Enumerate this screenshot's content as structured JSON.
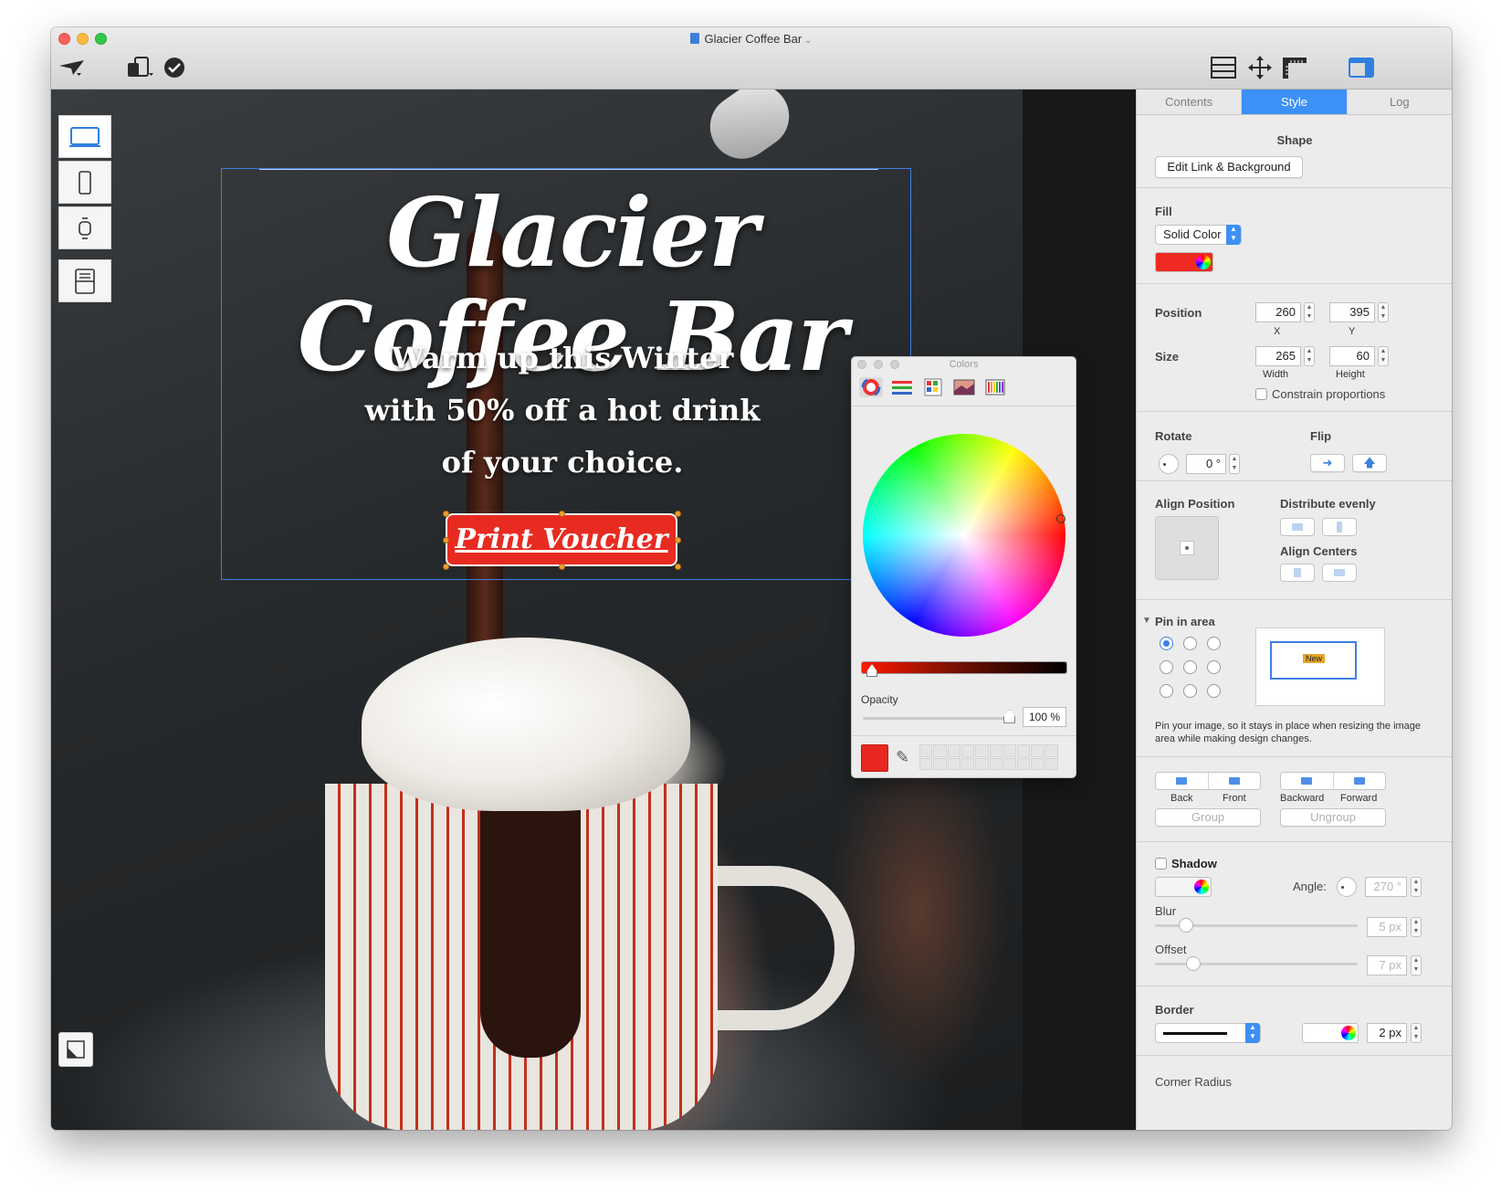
{
  "window": {
    "title": "Glacier Coffee Bar"
  },
  "toolbar": {
    "icons": [
      "paper-plane-icon",
      "devices-icon",
      "checkmark-icon",
      "layout-icon",
      "move-icon",
      "ruler-icon",
      "sidebar-icon"
    ]
  },
  "canvas": {
    "headline": "Glacier Coffee Bar",
    "subline": "Warm up this Winter with 50% off a hot drink of your choice.",
    "button_label": "Print Voucher",
    "device_buttons": [
      "desktop-icon",
      "phone-icon",
      "watch-icon",
      "email-icon"
    ]
  },
  "colors_panel": {
    "title": "Colors",
    "tabs": [
      "color-wheel-icon",
      "sliders-icon",
      "palettes-icon",
      "image-palette-icon",
      "pencils-icon"
    ],
    "opacity_label": "Opacity",
    "opacity_value": "100 %",
    "current_color": "#e8281f"
  },
  "inspector": {
    "tabs": [
      {
        "label": "Contents",
        "active": false
      },
      {
        "label": "Style",
        "active": true
      },
      {
        "label": "Log",
        "active": false
      }
    ],
    "shape": {
      "heading": "Shape",
      "edit_button": "Edit Link & Background"
    },
    "fill": {
      "label": "Fill",
      "type": "Solid Color",
      "color": "#ee2a22"
    },
    "position": {
      "label": "Position",
      "x": "260",
      "y": "395",
      "x_label": "X",
      "y_label": "Y"
    },
    "size": {
      "label": "Size",
      "width": "265",
      "height": "60",
      "width_label": "Width",
      "height_label": "Height",
      "constrain_label": "Constrain proportions"
    },
    "rotate": {
      "label": "Rotate",
      "value": "0 °"
    },
    "flip": {
      "label": "Flip"
    },
    "align": {
      "position_label": "Align Position",
      "distribute_label": "Distribute evenly",
      "centers_label": "Align Centers"
    },
    "pin": {
      "label": "Pin in area",
      "new_label": "New",
      "description": "Pin your image, so it stays in place when resizing the image area while making design changes."
    },
    "arrange": {
      "back": "Back",
      "front": "Front",
      "backward": "Backward",
      "forward": "Forward",
      "group": "Group",
      "ungroup": "Ungroup"
    },
    "shadow": {
      "label": "Shadow",
      "angle_label": "Angle:",
      "angle_value": "270 °",
      "blur_label": "Blur",
      "blur_value": "5 px",
      "offset_label": "Offset",
      "offset_value": "7 px"
    },
    "border": {
      "label": "Border",
      "width": "2 px"
    },
    "corner_radius": {
      "label": "Corner Radius"
    }
  }
}
